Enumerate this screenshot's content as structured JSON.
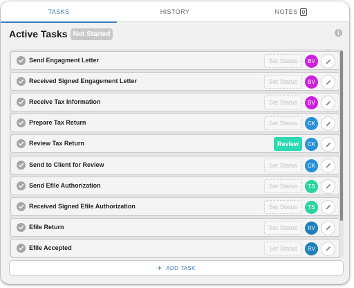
{
  "tabs": [
    {
      "label": "TASKS",
      "active": true
    },
    {
      "label": "HISTORY",
      "active": false
    },
    {
      "label": "NOTES",
      "count": "0",
      "active": false
    }
  ],
  "header": {
    "title": "Active Tasks",
    "status": "Not Started"
  },
  "tasks": [
    {
      "name": "Send Engagment Letter",
      "status": "Set Status",
      "assignee": "BV",
      "avatar_color": "#cc22dd"
    },
    {
      "name": "Received Signed Engagement Letter",
      "status": "Set Status",
      "assignee": "BV",
      "avatar_color": "#cc22dd"
    },
    {
      "name": "Receive Tax Information",
      "status": "Set Status",
      "assignee": "BV",
      "avatar_color": "#cc22dd"
    },
    {
      "name": "Prepare Tax Return",
      "status": "Set Status",
      "assignee": "CK",
      "avatar_color": "#2a8fd6"
    },
    {
      "name": "Review Tax Return",
      "status": "Review",
      "assignee": "CK",
      "avatar_color": "#2a8fd6"
    },
    {
      "name": "Send to Client for Review",
      "status": "Set Status",
      "assignee": "CK",
      "avatar_color": "#2a8fd6"
    },
    {
      "name": "Send Efile Authorization",
      "status": "Set Status",
      "assignee": "TS",
      "avatar_color": "#2ed3a2"
    },
    {
      "name": "Received Signed Efile Authorization",
      "status": "Set Status",
      "assignee": "TS",
      "avatar_color": "#2ed3a2"
    },
    {
      "name": "Efile Return",
      "status": "Set Status",
      "assignee": "RV",
      "avatar_color": "#1f7fb8"
    },
    {
      "name": "Efile Accepted",
      "status": "Set Status",
      "assignee": "RV",
      "avatar_color": "#1f7fb8"
    }
  ],
  "footer": {
    "add_task_label": "ADD TASK"
  },
  "colors": {
    "accent": "#3a7bbf",
    "review_status": "#2bd9b2"
  },
  "icons": {
    "info": "info-icon",
    "check": "check-circle-icon",
    "edit": "pencil-icon",
    "add": "plus-icon"
  }
}
